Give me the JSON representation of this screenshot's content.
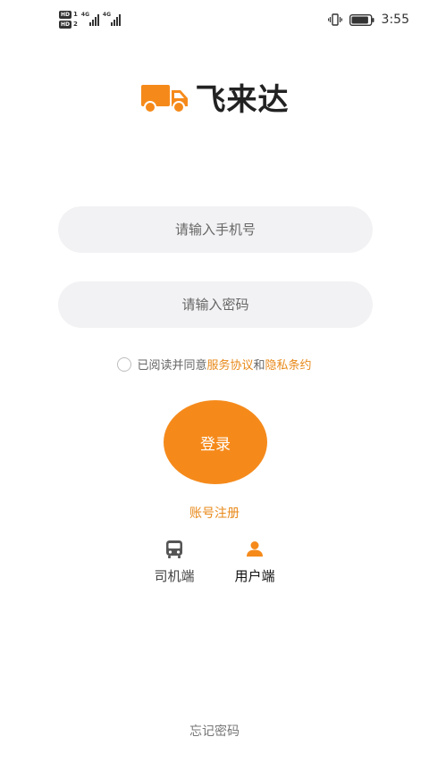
{
  "status_bar": {
    "sim1_badge": "HD",
    "sim1_slot": "1",
    "sim2_badge": "HD",
    "sim2_slot": "2",
    "sim1_network": "4G",
    "sim2_network": "4G",
    "time": "3:55",
    "battery_level": 0.9,
    "vibrate_icon": "vibrate-icon",
    "battery_icon": "battery-icon"
  },
  "logo": {
    "icon": "truck-icon",
    "text": "飞来达",
    "icon_color": "#f58a1b"
  },
  "form": {
    "phone_placeholder": "请输入手机号",
    "phone_value": "",
    "password_placeholder": "请输入密码",
    "password_value": ""
  },
  "agreement": {
    "checked": false,
    "prefix": "已阅读并同意",
    "terms_link": "服务协议",
    "joiner": "和",
    "privacy_link": "隐私条约"
  },
  "login_button": "登录",
  "register_link": "账号注册",
  "roles": [
    {
      "label": "司机端",
      "icon": "bus-icon",
      "active": false
    },
    {
      "label": "用户端",
      "icon": "user-icon",
      "active": true
    }
  ],
  "forgot_password": "忘记密码",
  "colors": {
    "accent": "#f58a1b",
    "link": "#e8891a",
    "input_bg": "#f2f2f4"
  }
}
